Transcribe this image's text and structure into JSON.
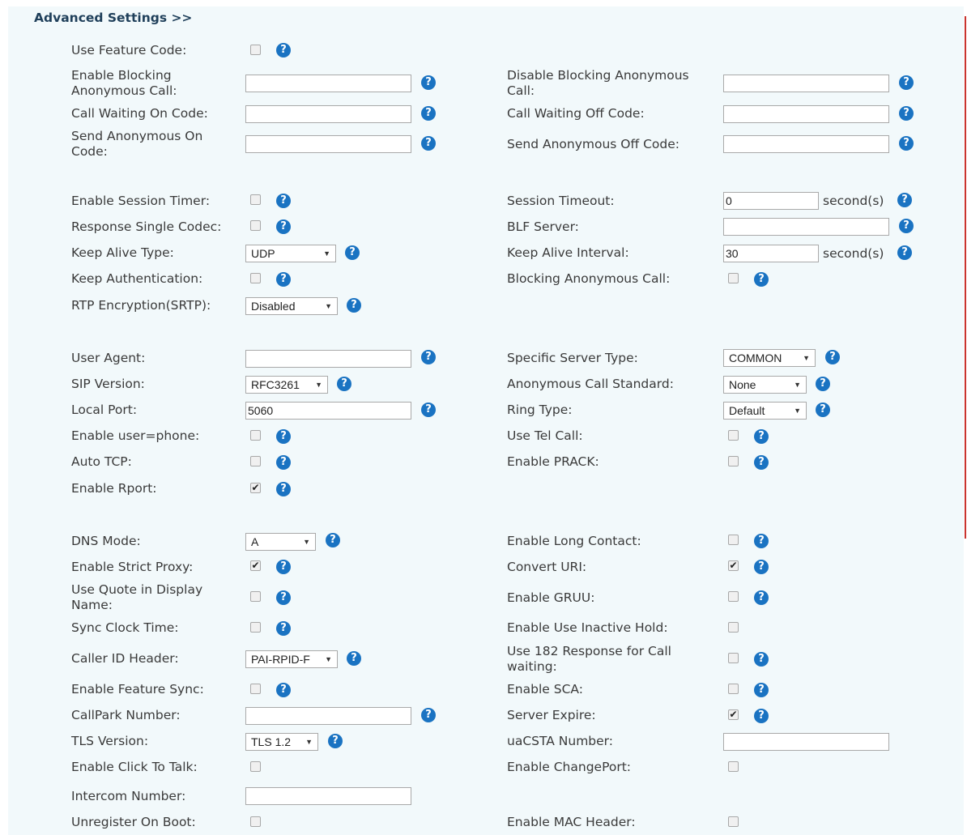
{
  "section_title": "Advanced Settings >>",
  "use_feature_code": "Use Feature Code:",
  "enable_blocking_anon_call": "Enable Blocking Anonymous Call:",
  "disable_blocking_anon_call": "Disable Blocking Anonymous Call:",
  "call_waiting_on_code": "Call Waiting On Code:",
  "call_waiting_off_code": "Call Waiting Off Code:",
  "send_anon_on_code": "Send Anonymous On Code:",
  "send_anon_off_code": "Send Anonymous Off Code:",
  "enable_session_timer": "Enable Session Timer:",
  "session_timeout": "Session Timeout:",
  "session_timeout_value": "0",
  "seconds_unit": "second(s)",
  "response_single_codec": "Response Single Codec:",
  "blf_server": "BLF Server:",
  "keep_alive_type": "Keep Alive Type:",
  "keep_alive_type_value": "UDP",
  "keep_alive_interval": "Keep Alive Interval:",
  "keep_alive_interval_value": "30",
  "keep_authentication": "Keep Authentication:",
  "blocking_anon_call": "Blocking Anonymous Call:",
  "rtp_encryption": "RTP Encryption(SRTP):",
  "rtp_encryption_value": "Disabled",
  "user_agent": "User Agent:",
  "specific_server_type": "Specific Server Type:",
  "specific_server_type_value": "COMMON",
  "sip_version": "SIP Version:",
  "sip_version_value": "RFC3261",
  "anon_call_standard": "Anonymous Call Standard:",
  "anon_call_standard_value": "None",
  "local_port": "Local Port:",
  "local_port_value": "5060",
  "ring_type": "Ring Type:",
  "ring_type_value": "Default",
  "enable_user_phone": "Enable user=phone:",
  "use_tel_call": "Use Tel Call:",
  "auto_tcp": "Auto TCP:",
  "enable_prack": "Enable PRACK:",
  "enable_rport": "Enable Rport:",
  "dns_mode": "DNS Mode:",
  "dns_mode_value": "A",
  "enable_long_contact": "Enable Long Contact:",
  "enable_strict_proxy": "Enable Strict Proxy:",
  "convert_uri": "Convert URI:",
  "use_quote_display_name": "Use Quote in Display Name:",
  "enable_gruu": "Enable GRUU:",
  "sync_clock_time": "Sync Clock Time:",
  "enable_use_inactive_hold": "Enable Use Inactive Hold:",
  "caller_id_header": "Caller ID Header:",
  "caller_id_header_value": "PAI-RPID-F",
  "use_182_response": "Use 182 Response for Call waiting:",
  "enable_feature_sync": "Enable Feature Sync:",
  "enable_sca": "Enable SCA:",
  "callpark_number": "CallPark Number:",
  "server_expire": "Server Expire:",
  "tls_version": "TLS Version:",
  "tls_version_value": "TLS 1.2",
  "uacsta_number": "uaCSTA Number:",
  "enable_click_to_talk": "Enable Click To Talk:",
  "enable_changeport": "Enable ChangePort:",
  "intercom_number": "Intercom Number:",
  "unregister_on_boot": "Unregister On Boot:",
  "enable_mac_header": "Enable MAC Header:",
  "help_glyph": "?",
  "check_glyph": "✔",
  "arrow_glyph": "▼",
  "colors": {
    "help": "#1a73c2",
    "panel": "#f2f9fb",
    "redline": "#c9342f"
  }
}
